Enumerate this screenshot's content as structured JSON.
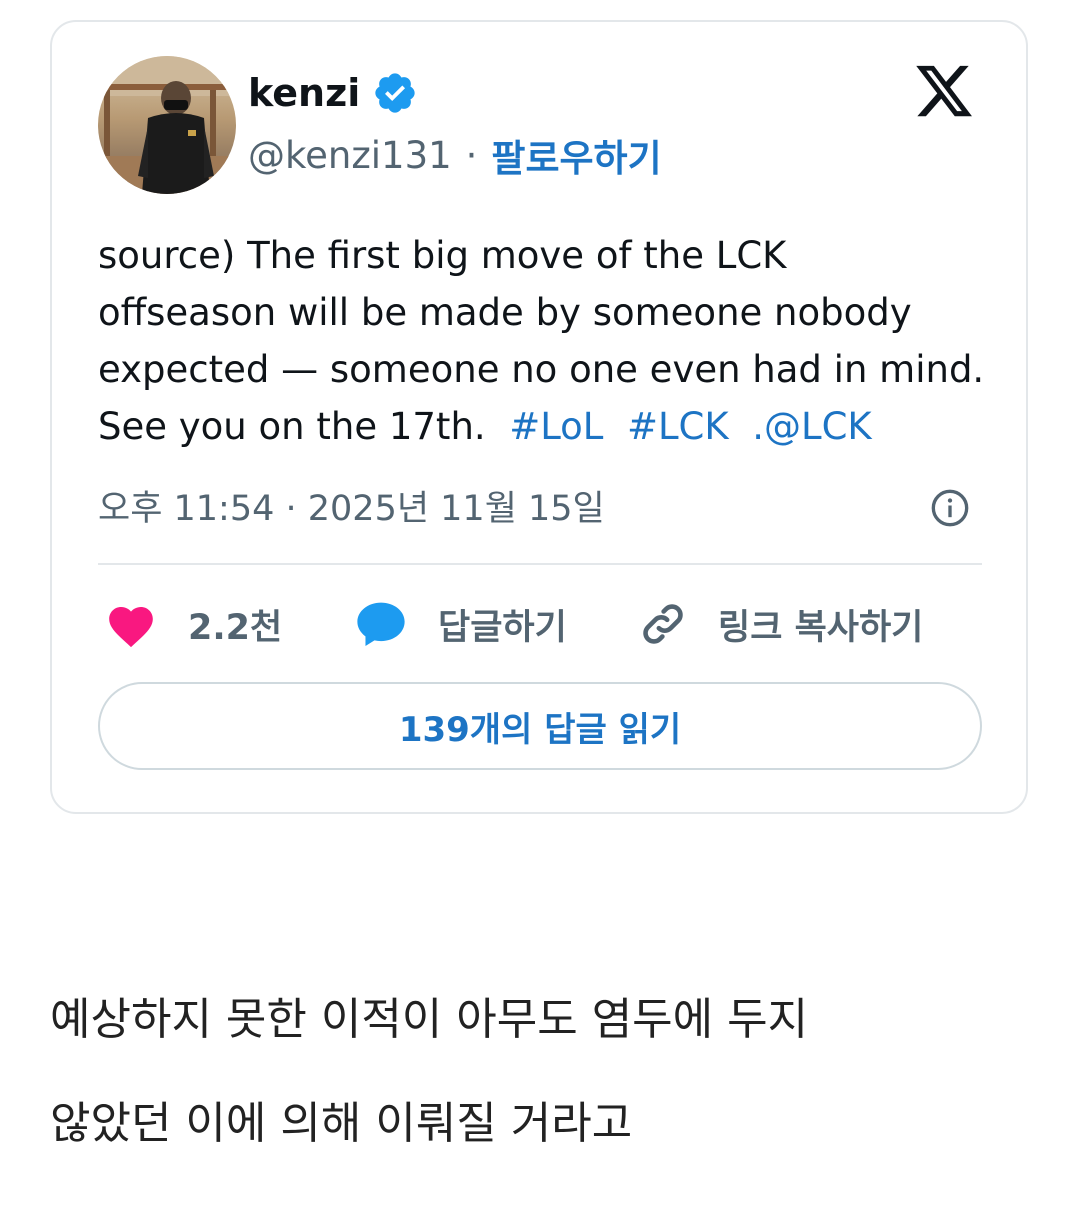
{
  "tweet": {
    "display_name": "kenzi",
    "handle": "@kenzi131",
    "separator": "·",
    "follow_label": "팔로우하기",
    "text_lines": [
      "source) The first big move of the LCK",
      "offseason will be made by someone nobody",
      "expected — someone no one even had in mind.",
      "See you on the 17th."
    ],
    "tags": [
      "#LoL",
      "#LCK",
      ".@LCK"
    ],
    "timestamp": "오후 11:54 · 2025년 11월 15일",
    "likes": "2.2천",
    "reply_label": "답글하기",
    "copy_link_label": "링크 복사하기",
    "read_replies_label": "139개의 답글 읽기"
  },
  "body": {
    "lines": [
      "예상하지 못한 이적이 아무도 염두에 두지",
      "않았던 이에 의해 이뤄질 거라고"
    ]
  },
  "icons": {
    "verified": "verified-badge-icon",
    "x_logo": "x-logo-icon",
    "info": "info-icon",
    "like": "heart-icon",
    "reply": "speech-bubble-icon",
    "link": "link-icon"
  },
  "colors": {
    "accent": "#1d74c4",
    "like": "#f91880",
    "reply": "#1d9bf0",
    "muted": "#536471"
  }
}
